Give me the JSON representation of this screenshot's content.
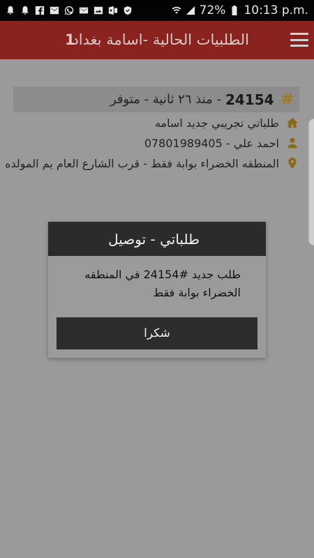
{
  "status_bar": {
    "battery": "72%",
    "time": "10:13 p.m.",
    "icons": [
      "notification-icon",
      "notification-icon",
      "facebook-icon",
      "mail-icon",
      "whatsapp-icon",
      "email-icon",
      "image-icon",
      "outlook-icon",
      "shield-icon"
    ]
  },
  "app_bar": {
    "title": "الطلبيات الحالية -اسامة بغداد",
    "title_num": "1"
  },
  "order": {
    "hash": "#",
    "number": "24154",
    "meta": "- منذ ٢٦ ثانية - متوفر",
    "store": "طلباتي تجريبي جديد اسامه",
    "customer": "احمد علي - 07801989405",
    "address": "المنطقه الخضراء بوابة فقط - قرب الشارع العام يم المولده"
  },
  "dialog": {
    "title": "طلباتي - توصيل",
    "message": "طلب جديد #24154 في المنطقه الخضراء بوابة فقط",
    "button": "شكرا"
  },
  "colors": {
    "app_bar": "#8a231f",
    "icon_accent": "#8a6a18",
    "dialog_dark": "#2a2c2c"
  }
}
